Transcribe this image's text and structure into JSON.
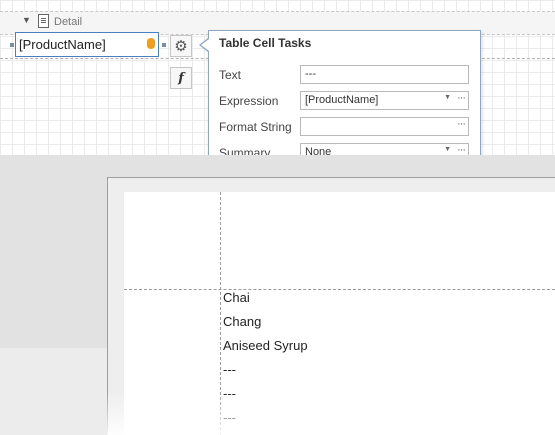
{
  "band": {
    "label": "Detail",
    "collapse_icon": "triangle-down-icon",
    "band_icon": "document-icon"
  },
  "table_cell": {
    "expression_text": "[ProductName]",
    "icon": "database-icon"
  },
  "smart_tag": {
    "icon": "gear-icon",
    "glyph": "⚙"
  },
  "expression_button": {
    "glyph": "f"
  },
  "tasks_panel": {
    "title": "Table Cell Tasks",
    "properties": [
      {
        "label": "Text",
        "value": "---",
        "has_dropdown": false,
        "has_ellipsis": false
      },
      {
        "label": "Expression",
        "value": "[ProductName]",
        "has_dropdown": true,
        "has_ellipsis": true
      },
      {
        "label": "Format String",
        "value": "",
        "has_dropdown": false,
        "has_ellipsis": true
      },
      {
        "label": "Summary",
        "value": "None",
        "has_dropdown": true,
        "has_ellipsis": true
      }
    ]
  },
  "preview": {
    "rows": [
      "Chai",
      "Chang",
      "Aniseed Syrup",
      "---",
      "---",
      "---"
    ]
  },
  "colors": {
    "cell_border": "#4a7fc1",
    "panel_border": "#8fa6c0",
    "db_icon": "#f0a020",
    "gray_background": "#e2e2e2"
  }
}
